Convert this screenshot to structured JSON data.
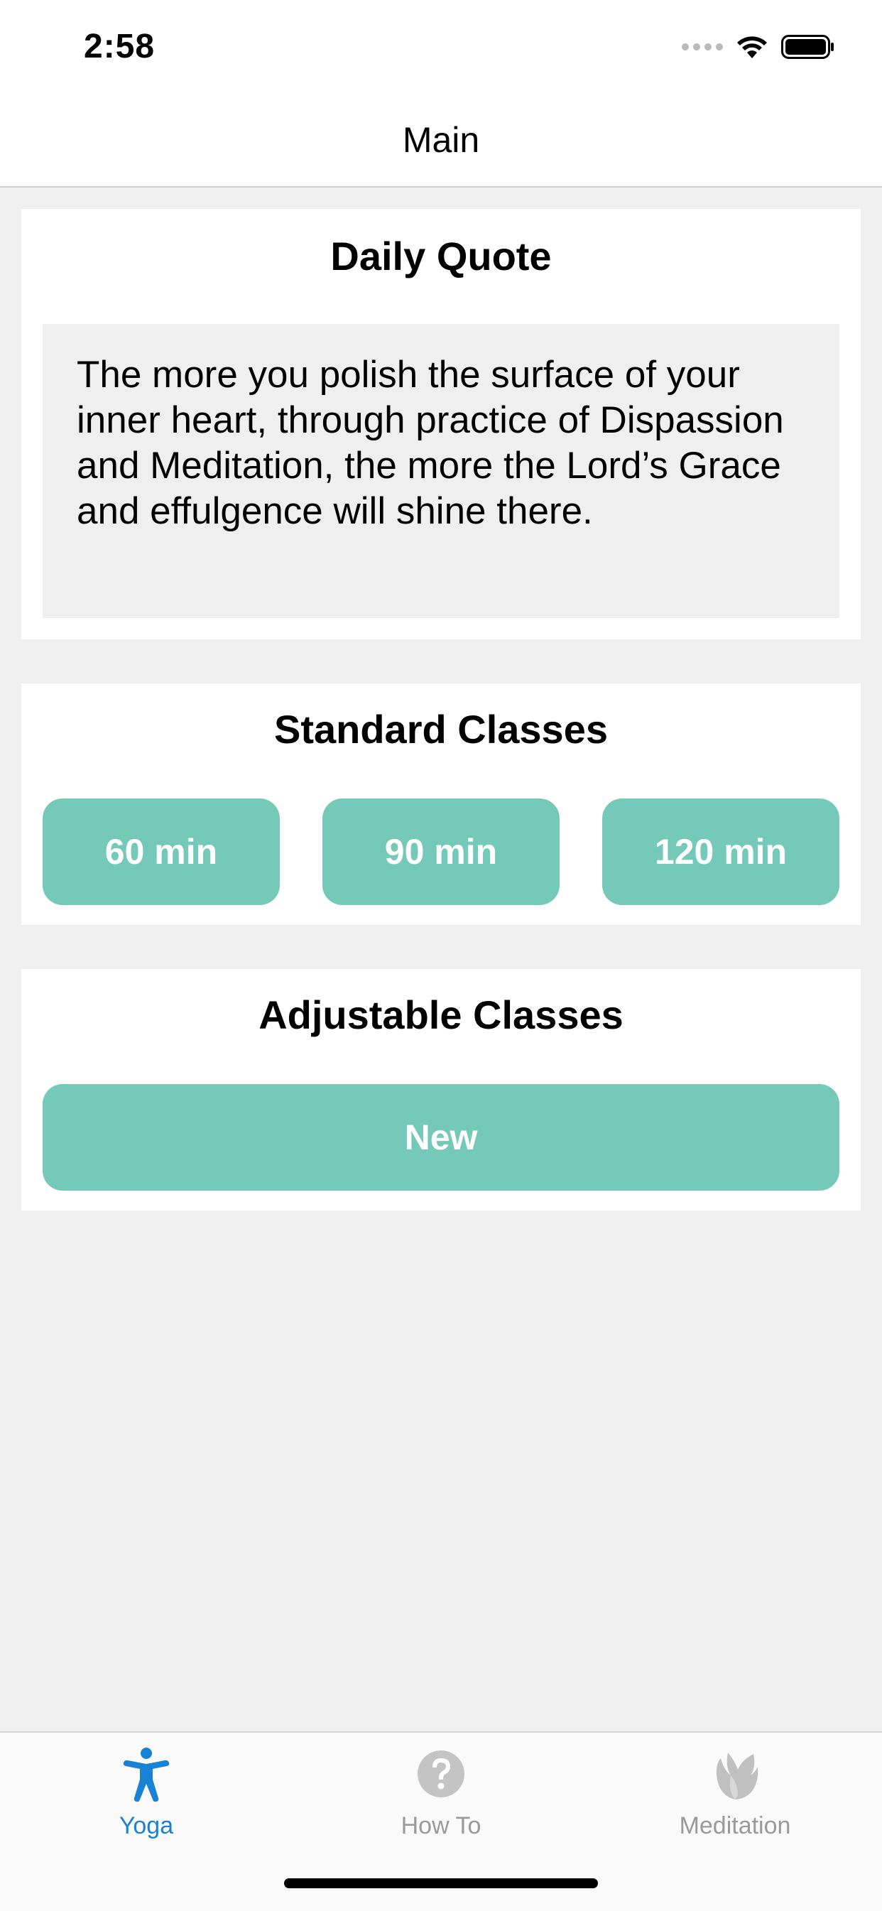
{
  "status_bar": {
    "time": "2:58"
  },
  "nav": {
    "title": "Main"
  },
  "quote_card": {
    "title": "Daily Quote",
    "quote": "The more you polish the surface of your inner heart, through practice of Dispassion and Meditation, the more the Lord’s Grace and effulgence will shine there."
  },
  "standard_card": {
    "title": "Standard Classes",
    "buttons": [
      "60 min",
      "90 min",
      "120 min"
    ]
  },
  "adjustable_card": {
    "title": "Adjustable Classes",
    "new_button": "New"
  },
  "tabbar": {
    "tabs": [
      {
        "label": "Yoga",
        "icon": "person-icon",
        "active": true
      },
      {
        "label": "How To",
        "icon": "question-circle-icon",
        "active": false
      },
      {
        "label": "Meditation",
        "icon": "lotus-icon",
        "active": false
      }
    ]
  },
  "colors": {
    "accent_teal": "#74c9b8",
    "active_tab": "#1a82d6",
    "inactive_tab": "#9a9a9a",
    "background": "#efefef"
  }
}
